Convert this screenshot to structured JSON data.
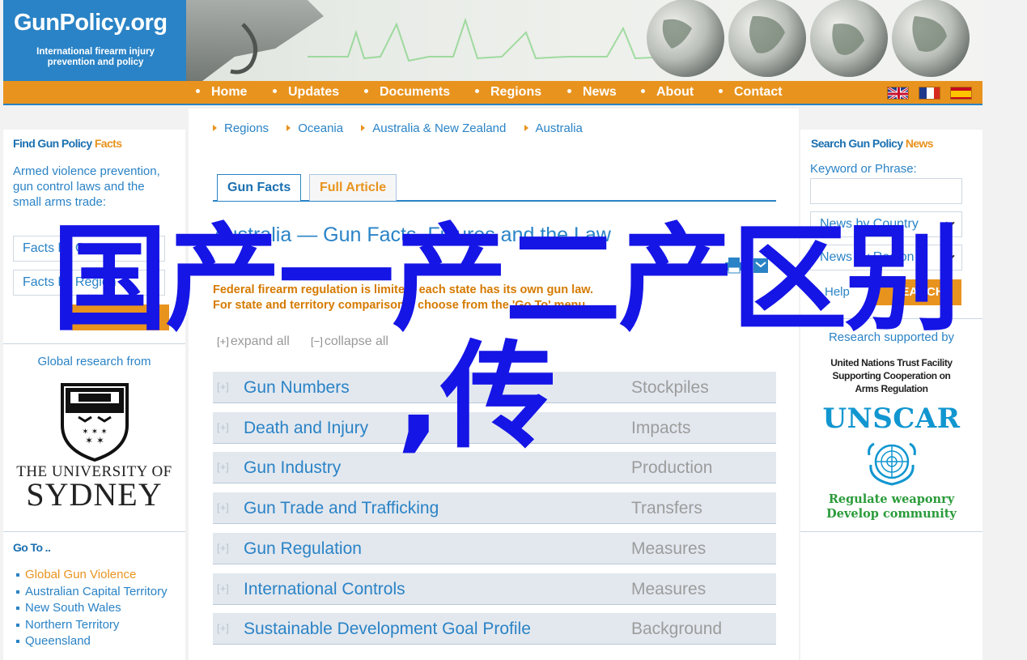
{
  "brand": {
    "title": "GunPolicy.org",
    "subtitle_line1": "International firearm injury",
    "subtitle_line2": "prevention and policy"
  },
  "nav": {
    "items": [
      "Home",
      "Updates",
      "Documents",
      "Regions",
      "News",
      "About",
      "Contact"
    ],
    "flags": [
      "flag-uk-icon",
      "flag-france-icon",
      "flag-spain-icon"
    ]
  },
  "left": {
    "find_title": "Find Gun Policy",
    "find_title_hl": "Facts",
    "description": "Armed violence prevention, gun control laws and the small arms trade:",
    "select1": "Facts by Country",
    "select2": "Facts by Region",
    "find_button": "FIND FACTS",
    "research_from": "Global research from",
    "university_line1": "THE UNIVERSITY OF",
    "university_line2": "SYDNEY",
    "goto_title": "Go To ..",
    "goto_items": [
      "Global Gun Violence",
      "Australian Capital Territory",
      "New South Wales",
      "Northern Territory",
      "Queensland"
    ]
  },
  "center": {
    "breadcrumbs": [
      "Regions",
      "Oceania",
      "Australia & New Zealand",
      "Australia"
    ],
    "tabs": [
      "Gun Facts",
      "Full Article"
    ],
    "page_title": "Australia — Gun Facts, Figures and the Law",
    "notice_line1": "Federal firearm regulation is limited: each state has its own gun law.",
    "notice_line2": "For state and territory comparisons, choose from the 'Go To' menu.",
    "expand_all": "expand all",
    "collapse_all": "collapse all",
    "expand_icon": "[+]",
    "collapse_icon": "[−]",
    "sections": [
      {
        "label": "Gun Numbers",
        "sub": "Stockpiles"
      },
      {
        "label": "Death and Injury",
        "sub": "Impacts"
      },
      {
        "label": "Gun Industry",
        "sub": "Production"
      },
      {
        "label": "Gun Trade and Trafficking",
        "sub": "Transfers"
      },
      {
        "label": "Gun Regulation",
        "sub": "Measures"
      },
      {
        "label": "International Controls",
        "sub": "Measures"
      },
      {
        "label": "Sustainable Development Goal Profile",
        "sub": "Background"
      }
    ]
  },
  "right": {
    "search_title": "Search Gun Policy",
    "search_title_hl": "News",
    "keyword_label": "Keyword or Phrase:",
    "keyword_value": "",
    "select1": "News by Country",
    "select2": "News by Region",
    "help_text": "Help",
    "search_button": "SEARCH",
    "research_supported": "Research supported by",
    "un_line1": "United Nations Trust Facility",
    "un_line2": "Supporting Cooperation on",
    "un_line3": "Arms Regulation",
    "unscar": "UNSCAR",
    "slogan1": "Regulate weaponry",
    "slogan2": "Develop community"
  },
  "overlay": {
    "line1": "国产一产二产区别",
    "line2": ",传"
  },
  "colors": {
    "brand_blue": "#2a83c6",
    "nav_orange": "#e8931e",
    "overlay_blue": "#1515e6",
    "un_green": "#2a9b3a"
  }
}
